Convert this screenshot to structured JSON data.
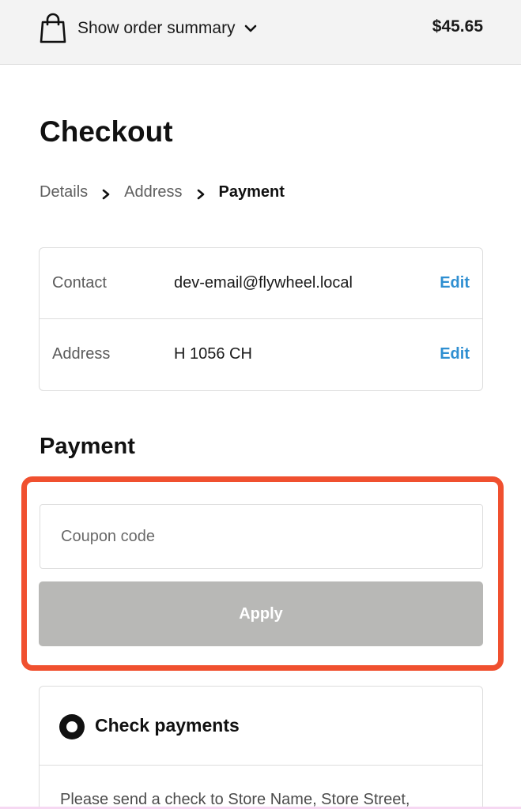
{
  "order_summary": {
    "toggle_label": "Show order summary",
    "total": "$45.65",
    "icon": "shopping-bag-icon"
  },
  "title": "Checkout",
  "breadcrumb": {
    "steps": [
      {
        "label": "Details"
      },
      {
        "label": "Address"
      },
      {
        "label": "Payment"
      }
    ],
    "current": "Payment"
  },
  "review": {
    "rows": [
      {
        "label": "Contact",
        "value": "dev-email@flywheel.local",
        "action": "Edit"
      },
      {
        "label": "Address",
        "value": "H 1056 CH",
        "action": "Edit"
      }
    ]
  },
  "payment": {
    "heading": "Payment",
    "coupon": {
      "placeholder": "Coupon code",
      "value": "",
      "apply_label": "Apply"
    },
    "methods": [
      {
        "label": "Check payments",
        "selected": true,
        "description": "Please send a check to Store Name, Store Street,"
      }
    ]
  },
  "colors": {
    "accent_link": "#2f8fd1",
    "highlight": "#f0502f",
    "apply_disabled": "#b8b8b6",
    "summary_bg": "#f3f3f3"
  }
}
